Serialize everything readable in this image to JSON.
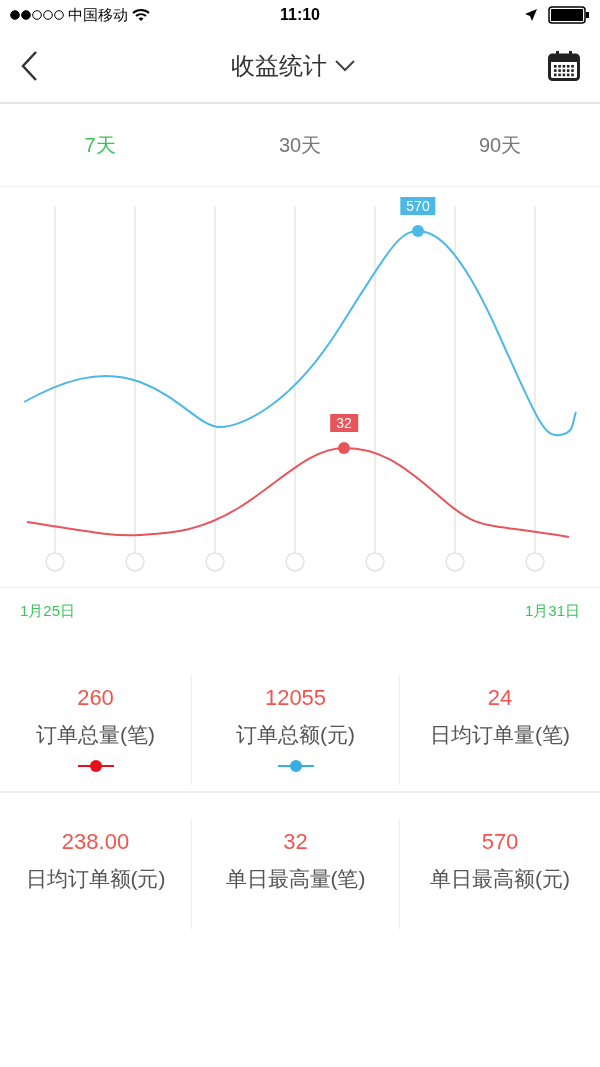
{
  "status_bar": {
    "carrier": "中国移动",
    "time": "11:10"
  },
  "nav": {
    "title": "收益统计"
  },
  "tabs": [
    {
      "label": "7天",
      "selected": true
    },
    {
      "label": "30天",
      "selected": false
    },
    {
      "label": "90天",
      "selected": false
    }
  ],
  "chart": {
    "series": [
      {
        "label": "570",
        "color": "#4bb8e6"
      },
      {
        "label": "32",
        "color": "#e8545c"
      }
    ],
    "start_date": "1月25日",
    "end_date": "1月31日"
  },
  "stats": [
    {
      "value": "260",
      "label": "订单总量(笔)",
      "color": "#e8101c"
    },
    {
      "value": "12055",
      "label": "订单总额(元)",
      "color": "#3aaee0"
    },
    {
      "value": "24",
      "label": "日均订单量(笔)"
    },
    {
      "value": "238.00",
      "label": "日均订单额(元)"
    },
    {
      "value": "32",
      "label": "单日最高量(笔)"
    },
    {
      "value": "570",
      "label": "单日最高额(元)"
    }
  ]
}
